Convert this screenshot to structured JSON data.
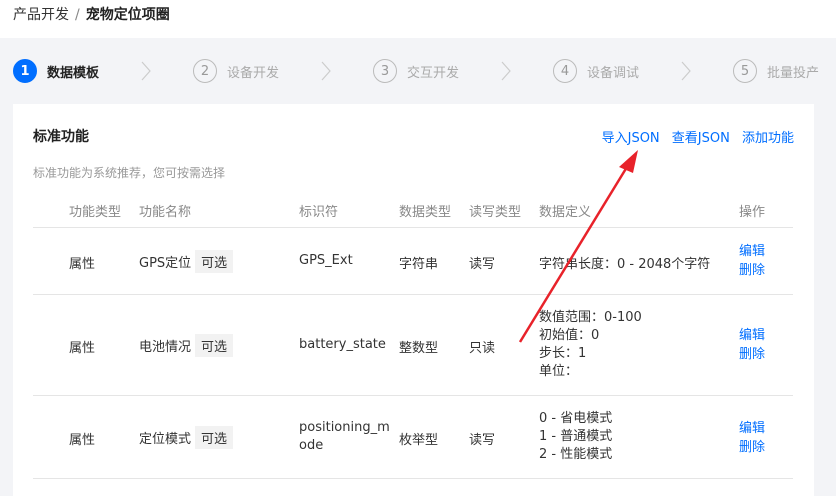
{
  "breadcrumb": {
    "parent": "产品开发",
    "separator": "/",
    "current": "宠物定位项圈"
  },
  "steps": [
    {
      "num": "1",
      "label": "数据模板",
      "active": true
    },
    {
      "num": "2",
      "label": "设备开发",
      "active": false
    },
    {
      "num": "3",
      "label": "交互开发",
      "active": false
    },
    {
      "num": "4",
      "label": "设备调试",
      "active": false
    },
    {
      "num": "5",
      "label": "批量投产",
      "active": false
    }
  ],
  "card": {
    "title": "标准功能",
    "description": "标准功能为系统推荐，您可按需选择",
    "actions": {
      "import_json": "导入JSON",
      "view_json": "查看JSON",
      "add_feature": "添加功能"
    }
  },
  "table": {
    "headers": {
      "type": "功能类型",
      "name": "功能名称",
      "identifier": "标识符",
      "data_type": "数据类型",
      "rw_type": "读写类型",
      "definition": "数据定义",
      "operation": "操作"
    },
    "rows": [
      {
        "type": "属性",
        "name": "GPS定位",
        "tag": "可选",
        "identifier": "GPS_Ext",
        "data_type": "字符串",
        "rw_type": "读写",
        "definition": [
          "字符串长度：0 - 2048个字符"
        ],
        "edit": "编辑",
        "delete": "删除"
      },
      {
        "type": "属性",
        "name": "电池情况",
        "tag": "可选",
        "identifier": "battery_state",
        "data_type": "整数型",
        "rw_type": "只读",
        "definition": [
          "数值范围：0-100",
          "初始值：0",
          "步长：1",
          "单位："
        ],
        "edit": "编辑",
        "delete": "删除"
      },
      {
        "type": "属性",
        "name": "定位模式",
        "tag": "可选",
        "identifier_lines": [
          "positioning_m",
          "ode"
        ],
        "data_type": "枚举型",
        "rw_type": "读写",
        "definition": [
          "0 - 省电模式",
          "1 - 普通模式",
          "2 - 性能模式"
        ],
        "edit": "编辑",
        "delete": "删除"
      }
    ]
  },
  "colors": {
    "accent": "#006eff",
    "annotation_arrow": "#e8222a"
  }
}
